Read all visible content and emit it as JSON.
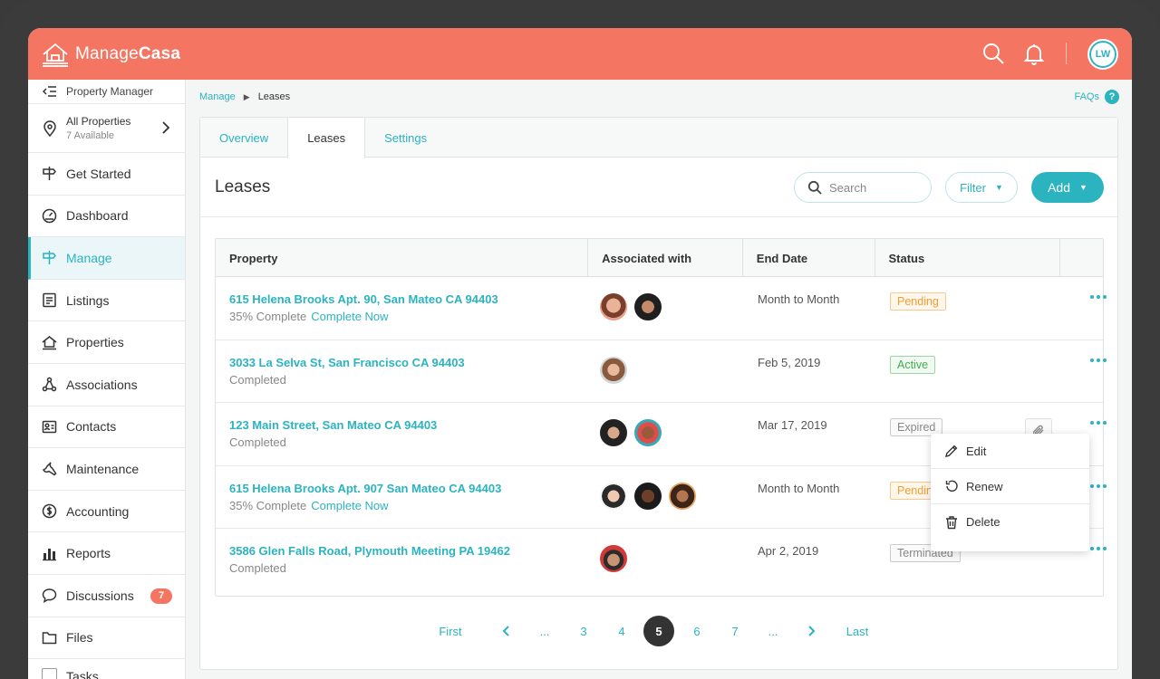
{
  "app": {
    "brand_regular": "Manage",
    "brand_bold": "Casa",
    "user_initials": "LW"
  },
  "colors": {
    "brand": "#f47561",
    "accent": "#2bb3c0"
  },
  "sidebar": {
    "role": "Property Manager",
    "property_selector": {
      "title": "All Properties",
      "subtitle": "7 Available"
    },
    "items": [
      {
        "label": "Get Started",
        "icon": "signpost-icon"
      },
      {
        "label": "Dashboard",
        "icon": "gauge-icon"
      },
      {
        "label": "Manage",
        "icon": "signpost-icon",
        "active": true
      },
      {
        "label": "Listings",
        "icon": "listing-icon"
      },
      {
        "label": "Properties",
        "icon": "house-icon"
      },
      {
        "label": "Associations",
        "icon": "network-icon"
      },
      {
        "label": "Contacts",
        "icon": "contact-card-icon"
      },
      {
        "label": "Maintenance",
        "icon": "wrench-icon"
      },
      {
        "label": "Accounting",
        "icon": "dollar-icon"
      },
      {
        "label": "Reports",
        "icon": "bar-chart-icon"
      },
      {
        "label": "Discussions",
        "icon": "chat-icon",
        "badge": "7"
      },
      {
        "label": "Files",
        "icon": "folder-icon"
      }
    ],
    "partial_item": "Tasks"
  },
  "breadcrumb": {
    "root": "Manage",
    "current": "Leases"
  },
  "faqs": {
    "label": "FAQs",
    "icon_text": "?"
  },
  "tabs": [
    {
      "label": "Overview"
    },
    {
      "label": "Leases",
      "active": true
    },
    {
      "label": "Settings"
    }
  ],
  "panel": {
    "title": "Leases",
    "search_placeholder": "Search",
    "filter_label": "Filter",
    "add_label": "Add"
  },
  "table": {
    "headers": [
      "Property",
      "Associated with",
      "End Date",
      "Status"
    ],
    "rows": [
      {
        "address": "615 Helena Brooks Apt. 90, San Mateo CA 94403",
        "progress": "35% Complete",
        "action": "Complete Now",
        "end_date": "Month to Month",
        "status": "Pending",
        "avatars": 2
      },
      {
        "address": "3033 La Selva St, San Francisco CA 94403",
        "progress": "Completed",
        "action": "",
        "end_date": "Feb 5, 2019",
        "status": "Active",
        "avatars": 1
      },
      {
        "address": "123 Main Street, San Mateo CA 94403",
        "progress": "Completed",
        "action": "",
        "end_date": "Mar 17, 2019",
        "status": "Expired",
        "avatars": 2
      },
      {
        "address": "615 Helena Brooks Apt. 907 San Mateo CA 94403",
        "progress": "35% Complete",
        "action": "Complete Now",
        "end_date": "Month to Month",
        "status": "Pending",
        "avatars": 3
      },
      {
        "address": "3586 Glen Falls Road, Plymouth Meeting PA 19462",
        "progress": "Completed",
        "action": "",
        "end_date": "Apr 2, 2019",
        "status": "Terminated",
        "avatars": 1
      }
    ]
  },
  "context_menu": {
    "items": [
      "Edit",
      "Renew",
      "Delete"
    ]
  },
  "pagination": {
    "first": "First",
    "last": "Last",
    "ellipsis": "...",
    "pages": [
      "3",
      "4",
      "5",
      "6",
      "7"
    ],
    "current": "5"
  }
}
